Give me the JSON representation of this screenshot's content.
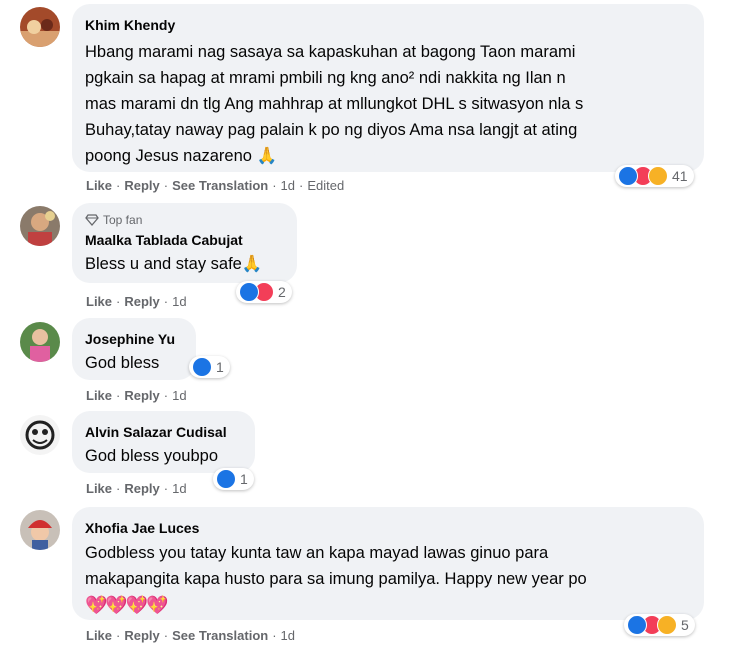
{
  "comments": [
    {
      "name": "Khim Khendy",
      "top_fan": "",
      "text_lines": [
        "Hbang marami nag sasaya sa kapaskuhan at bagong Taon marami",
        "pgkain sa hapag at mrami pmbili ng kng ano² ndi nakkita ng Ilan n",
        "mas marami dn tlg Ang mahhrap at mllungkot DHL s sitwasyon nla s",
        "Buhay,tatay naway pag palain k po ng diyos Ama nsa langjt at ating",
        "poong Jesus nazareno 🙏"
      ],
      "actions": {
        "like": "Like",
        "reply": "Reply",
        "translate": "See Translation",
        "time": "1d",
        "edited": "Edited"
      },
      "reactions": {
        "count": "41",
        "types": [
          "like",
          "love",
          "care"
        ]
      }
    },
    {
      "name": "Maalka Tablada Cabujat",
      "top_fan": "Top fan",
      "text_lines": [
        "Bless u and stay safe🙏"
      ],
      "actions": {
        "like": "Like",
        "reply": "Reply",
        "time": "1d"
      },
      "reactions": {
        "count": "2",
        "types": [
          "like",
          "love"
        ]
      }
    },
    {
      "name": "Josephine Yu",
      "top_fan": "",
      "text_lines": [
        "God bless"
      ],
      "actions": {
        "like": "Like",
        "reply": "Reply",
        "time": "1d"
      },
      "reactions": {
        "count": "1",
        "types": [
          "like"
        ]
      }
    },
    {
      "name": "Alvin Salazar Cudisal",
      "top_fan": "",
      "text_lines": [
        "God bless youbpo"
      ],
      "actions": {
        "like": "Like",
        "reply": "Reply",
        "time": "1d"
      },
      "reactions": {
        "count": "1",
        "types": [
          "like"
        ]
      }
    },
    {
      "name": "Xhofia Jae Luces",
      "top_fan": "",
      "text_lines": [
        "Godbless you tatay kunta taw an kapa mayad lawas ginuo para",
        "makapangita kapa husto para sa imung pamilya. Happy new year po",
        "💖💖💖💖"
      ],
      "actions": {
        "like": "Like",
        "reply": "Reply",
        "translate": "See Translation",
        "time": "1d"
      },
      "reactions": {
        "count": "5",
        "types": [
          "like",
          "love",
          "care"
        ]
      }
    }
  ],
  "colors": {
    "bubble": "#f0f2f5",
    "secondary_text": "#65676b",
    "like_blue": "#1b74e4",
    "love_red": "#f33e58",
    "care_yellow": "#f7b125"
  },
  "icons": {
    "top_fan": "diamond-icon",
    "like": "like-reaction-icon",
    "love": "love-reaction-icon",
    "care": "care-reaction-icon"
  }
}
